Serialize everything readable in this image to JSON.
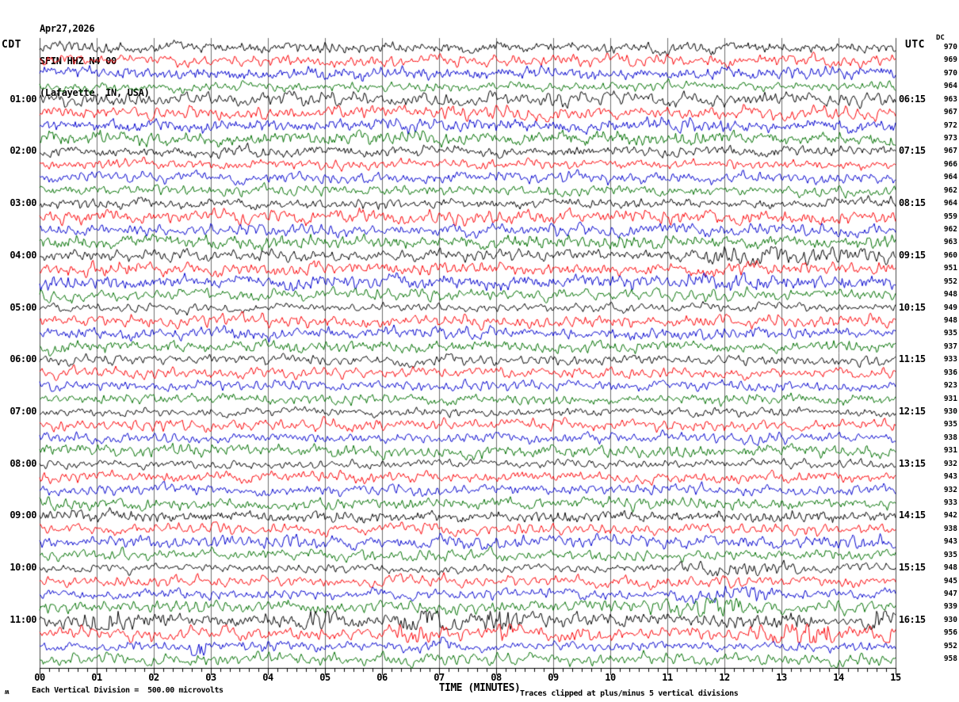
{
  "header": {
    "date": "Apr27,2026",
    "station": "SFIN HHZ N4 00",
    "location": "(Lafayette, IN, USA)",
    "left_tz": "CDT",
    "right_tz": "UTC",
    "dc_label": "DC"
  },
  "footer": {
    "axis_label": "TIME (MINUTES)",
    "scale_note": "Each Vertical Division =  500.00 microvolts",
    "clip_note": "Traces clipped at plus/minus 5 vertical divisions",
    "corner_glyph": "ʍ"
  },
  "x_axis": {
    "title": "TIME (MINUTES)",
    "ticks": [
      "00",
      "01",
      "02",
      "03",
      "04",
      "05",
      "06",
      "07",
      "08",
      "09",
      "10",
      "11",
      "12",
      "13",
      "14",
      "15"
    ],
    "minutes_per_line": 15,
    "minor_ticks_per_minute": 6,
    "grid": true
  },
  "colors": {
    "black": "#000000",
    "red": "#fb0006",
    "blue": "#0000cd",
    "green": "#007000",
    "grid": "#6e6e6e",
    "frame": "#444444"
  },
  "chart_data": {
    "type": "line",
    "title": "Helicorder seismogram SFIN HHZ N4 00 (Lafayette, IN, USA) Apr27,2026",
    "xlabel": "TIME (MINUTES)",
    "xlim": [
      0,
      15
    ],
    "rows_per_hour": 4,
    "row_duration_minutes": 15,
    "left_times_cdt": [
      "01:00",
      "02:00",
      "03:00",
      "04:00",
      "05:00",
      "06:00",
      "07:00",
      "08:00",
      "09:00",
      "10:00",
      "11:00"
    ],
    "right_times_utc": [
      "06:15",
      "07:15",
      "08:15",
      "09:15",
      "10:15",
      "11:15",
      "12:15",
      "13:15",
      "14:15",
      "15:15",
      "16:15"
    ],
    "rows": [
      {
        "c": "black",
        "dc": 970
      },
      {
        "c": "red",
        "dc": 969
      },
      {
        "c": "blue",
        "dc": 970
      },
      {
        "c": "green",
        "dc": 964
      },
      {
        "c": "black",
        "dc": 963,
        "cdt": "01:00",
        "utc": "06:15"
      },
      {
        "c": "red",
        "dc": 967
      },
      {
        "c": "blue",
        "dc": 972
      },
      {
        "c": "green",
        "dc": 973
      },
      {
        "c": "black",
        "dc": 967,
        "cdt": "02:00",
        "utc": "07:15"
      },
      {
        "c": "red",
        "dc": 966
      },
      {
        "c": "blue",
        "dc": 964
      },
      {
        "c": "green",
        "dc": 962
      },
      {
        "c": "black",
        "dc": 964,
        "cdt": "03:00",
        "utc": "08:15"
      },
      {
        "c": "red",
        "dc": 959
      },
      {
        "c": "blue",
        "dc": 962
      },
      {
        "c": "green",
        "dc": 963
      },
      {
        "c": "black",
        "dc": 960,
        "cdt": "04:00",
        "utc": "09:15",
        "bursts": [
          [
            11.2,
            15,
            1.75
          ]
        ]
      },
      {
        "c": "red",
        "dc": 951,
        "bursts": [
          [
            0,
            2.5,
            1.3
          ]
        ]
      },
      {
        "c": "blue",
        "dc": 952,
        "bursts": [
          [
            11.2,
            15,
            1.4
          ]
        ]
      },
      {
        "c": "green",
        "dc": 948
      },
      {
        "c": "black",
        "dc": 949,
        "cdt": "05:00",
        "utc": "10:15"
      },
      {
        "c": "red",
        "dc": 948
      },
      {
        "c": "blue",
        "dc": 935
      },
      {
        "c": "green",
        "dc": 937
      },
      {
        "c": "black",
        "dc": 933,
        "cdt": "06:00",
        "utc": "11:15"
      },
      {
        "c": "red",
        "dc": 936
      },
      {
        "c": "blue",
        "dc": 923
      },
      {
        "c": "green",
        "dc": 931
      },
      {
        "c": "black",
        "dc": 930,
        "cdt": "07:00",
        "utc": "12:15"
      },
      {
        "c": "red",
        "dc": 935
      },
      {
        "c": "blue",
        "dc": 938
      },
      {
        "c": "green",
        "dc": 931
      },
      {
        "c": "black",
        "dc": 932,
        "cdt": "08:00",
        "utc": "13:15"
      },
      {
        "c": "red",
        "dc": 943
      },
      {
        "c": "blue",
        "dc": 932
      },
      {
        "c": "green",
        "dc": 933
      },
      {
        "c": "black",
        "dc": 942,
        "cdt": "09:00",
        "utc": "14:15"
      },
      {
        "c": "red",
        "dc": 938
      },
      {
        "c": "blue",
        "dc": 943
      },
      {
        "c": "green",
        "dc": 935
      },
      {
        "c": "black",
        "dc": 948,
        "cdt": "10:00",
        "utc": "15:15",
        "bursts": [
          [
            10.7,
            13.8,
            1.8
          ]
        ]
      },
      {
        "c": "red",
        "dc": 945
      },
      {
        "c": "blue",
        "dc": 947,
        "bursts": [
          [
            10.8,
            13.6,
            1.6
          ]
        ]
      },
      {
        "c": "green",
        "dc": 939,
        "bursts": [
          [
            10.8,
            12.6,
            2.2
          ]
        ]
      },
      {
        "c": "black",
        "dc": 930,
        "cdt": "11:00",
        "utc": "16:15",
        "bursts": [
          [
            0,
            15,
            1.35
          ],
          [
            0.1,
            2.5,
            2.1
          ],
          [
            4.5,
            5.3,
            2.5
          ],
          [
            6.2,
            7.4,
            3.4
          ],
          [
            7.7,
            8.4,
            2.7
          ],
          [
            12.9,
            13.7,
            2.0
          ],
          [
            14.4,
            15,
            3.0
          ]
        ]
      },
      {
        "c": "red",
        "dc": 956,
        "bursts": [
          [
            6.2,
            6.9,
            2.2
          ],
          [
            7.8,
            8.5,
            1.8
          ],
          [
            8.8,
            10.2,
            1.4
          ],
          [
            12.5,
            14.2,
            3.0
          ],
          [
            14.5,
            15,
            2.7
          ]
        ]
      },
      {
        "c": "blue",
        "dc": 952,
        "bursts": [
          [
            2.6,
            3.0,
            2.6
          ],
          [
            3.5,
            4.6,
            1.5
          ],
          [
            6.8,
            7.3,
            2.3
          ]
        ]
      },
      {
        "c": "green",
        "dc": 958
      }
    ],
    "notes": "Traces clipped at plus/minus 5 vertical divisions; each vertical division = 500.00 microvolts"
  }
}
